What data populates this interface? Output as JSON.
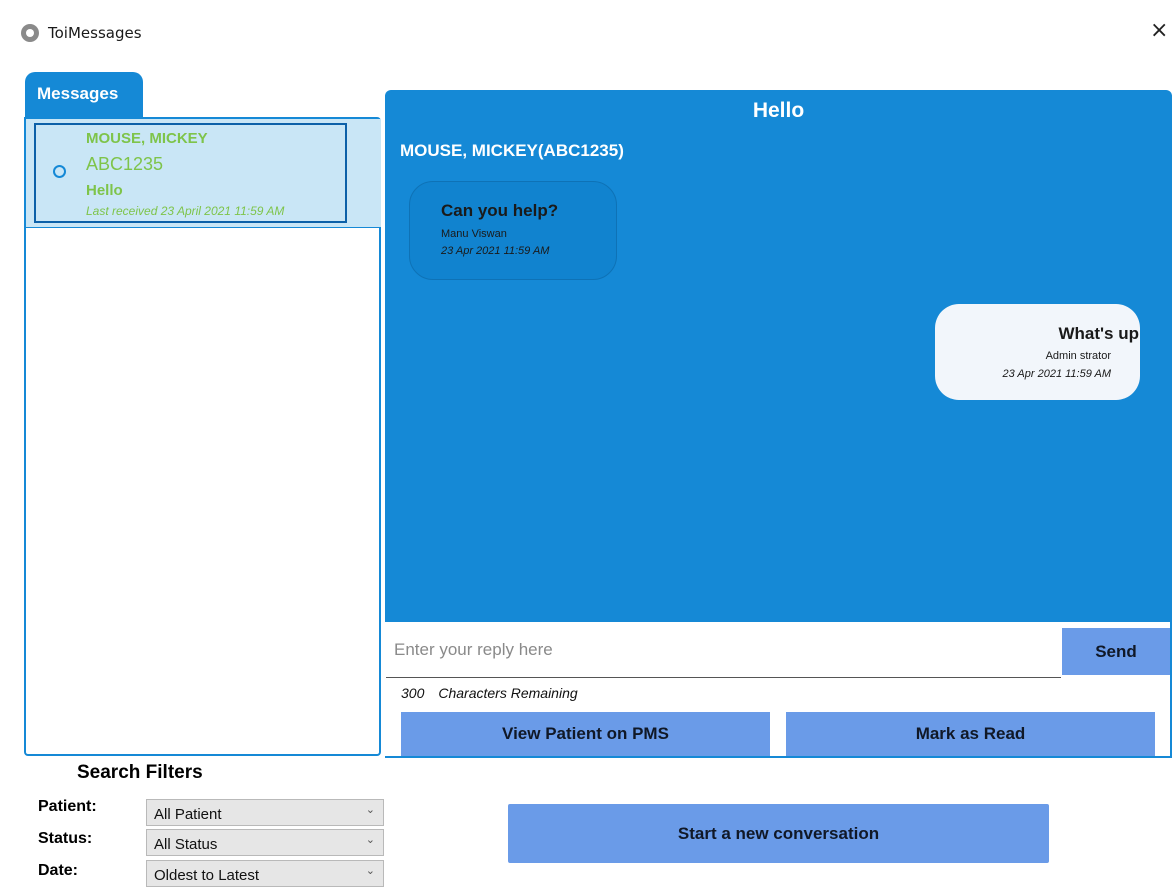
{
  "window": {
    "title": "ToiMessages",
    "close_glyph": "×"
  },
  "tabs": [
    {
      "label": "Messages"
    }
  ],
  "message_list": [
    {
      "name": "MOUSE, MICKEY",
      "patient_id": "ABC1235",
      "subject": "Hello",
      "last_received": "Last received 23 April 2021 11:59 AM",
      "unread": true
    }
  ],
  "conversation": {
    "subject": "Hello",
    "patient": "MOUSE, MICKEY(ABC1235)",
    "messages": [
      {
        "direction": "incoming",
        "text": "Can you help?",
        "sender": "Manu Viswan",
        "time": "23 Apr 2021 11:59 AM"
      },
      {
        "direction": "outgoing",
        "text": "What's up",
        "sender": "Admin strator",
        "time": "23 Apr 2021 11:59 AM"
      }
    ]
  },
  "reply": {
    "placeholder": "Enter your reply here",
    "value": "",
    "send_label": "Send",
    "chars_remaining": "300",
    "chars_remaining_label": "Characters Remaining"
  },
  "actions": {
    "view_patient": "View Patient on PMS",
    "mark_read": "Mark as Read",
    "new_conversation": "Start a new conversation"
  },
  "filters": {
    "title": "Search Filters",
    "patient": {
      "label": "Patient:",
      "value": "All Patient"
    },
    "status": {
      "label": "Status:",
      "value": "All Status"
    },
    "date": {
      "label": "Date:",
      "value": "Oldest to Latest"
    }
  },
  "icons": {
    "app": "toimessages-app-icon",
    "close": "close-icon",
    "dropdown": "chevron-down-icon",
    "unread": "unread-indicator-icon"
  },
  "colors": {
    "accent": "#1589d6",
    "button": "#6a9be8",
    "unread_text": "#7ec44a",
    "selected_item_bg": "#c9e6f6",
    "outgoing_bubble": "#f2f6fb"
  }
}
